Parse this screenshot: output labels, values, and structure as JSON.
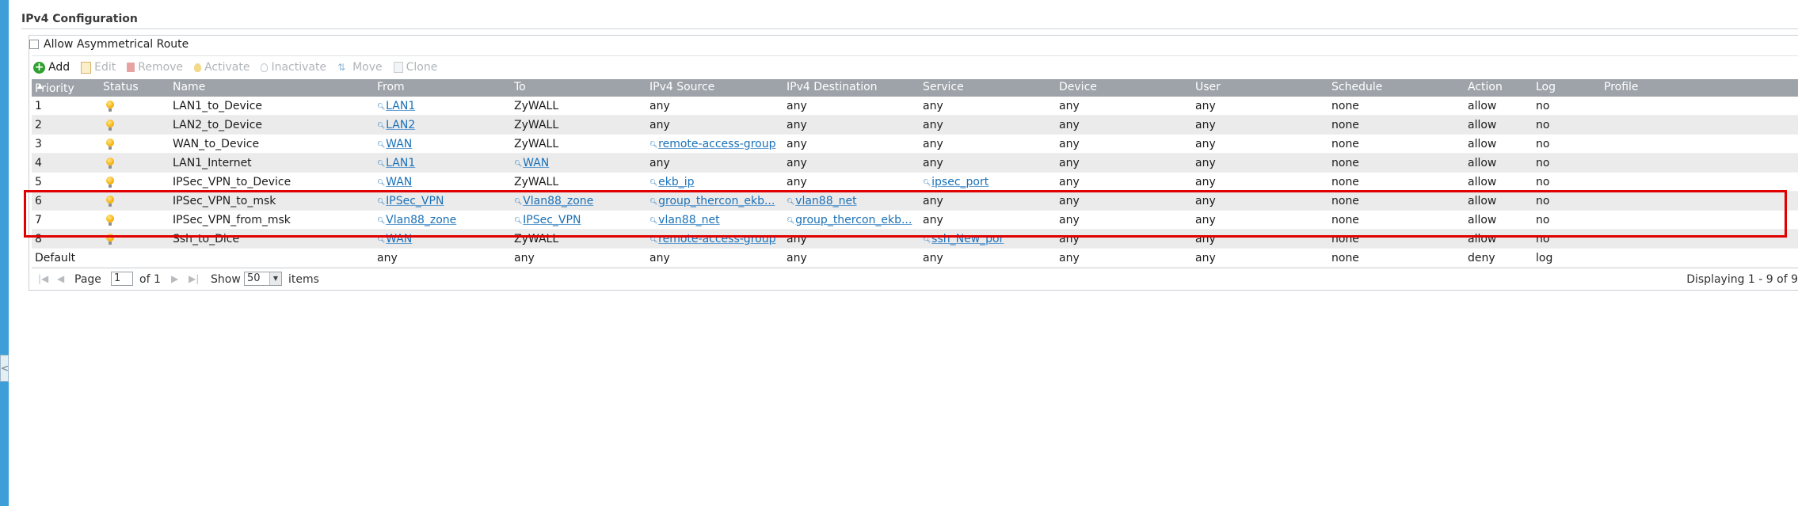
{
  "section_title": "IPv4 Configuration",
  "asymmetrical_route": {
    "label": "Allow Asymmetrical Route",
    "checked": false
  },
  "toolbar": {
    "add": "Add",
    "edit": "Edit",
    "remove": "Remove",
    "activate": "Activate",
    "inactivate": "Inactivate",
    "move": "Move",
    "clone": "Clone"
  },
  "columns": {
    "priority": "Priority",
    "status": "Status",
    "name": "Name",
    "from": "From",
    "to": "To",
    "ipv4_source": "IPv4 Source",
    "ipv4_destination": "IPv4 Destination",
    "service": "Service",
    "device": "Device",
    "user": "User",
    "schedule": "Schedule",
    "action": "Action",
    "log": "Log",
    "profile": "Profile"
  },
  "rows": [
    {
      "priority": "1",
      "name": "LAN1_to_Device",
      "from": "LAN1",
      "to": "ZyWALL",
      "source": "any",
      "destination": "any",
      "service": "any",
      "device": "any",
      "user": "any",
      "schedule": "none",
      "action": "allow",
      "log": "no"
    },
    {
      "priority": "2",
      "name": "LAN2_to_Device",
      "from": "LAN2",
      "to": "ZyWALL",
      "source": "any",
      "destination": "any",
      "service": "any",
      "device": "any",
      "user": "any",
      "schedule": "none",
      "action": "allow",
      "log": "no"
    },
    {
      "priority": "3",
      "name": "WAN_to_Device",
      "from": "WAN",
      "to": "ZyWALL",
      "source": "remote-access-group",
      "destination": "any",
      "service": "any",
      "device": "any",
      "user": "any",
      "schedule": "none",
      "action": "allow",
      "log": "no"
    },
    {
      "priority": "4",
      "name": "LAN1_Internet",
      "from": "LAN1",
      "to": "WAN",
      "source": "any",
      "destination": "any",
      "service": "any",
      "device": "any",
      "user": "any",
      "schedule": "none",
      "action": "allow",
      "log": "no"
    },
    {
      "priority": "5",
      "name": "IPSec_VPN_to_Device",
      "from": "WAN",
      "to": "ZyWALL",
      "source": "ekb_ip",
      "destination": "any",
      "service": "ipsec_port",
      "device": "any",
      "user": "any",
      "schedule": "none",
      "action": "allow",
      "log": "no"
    },
    {
      "priority": "6",
      "name": "IPSec_VPN_to_msk",
      "from": "IPSec_VPN",
      "to": "Vlan88_zone",
      "source": "group_thercon_ekb...",
      "destination": "vlan88_net",
      "service": "any",
      "device": "any",
      "user": "any",
      "schedule": "none",
      "action": "allow",
      "log": "no"
    },
    {
      "priority": "7",
      "name": "IPSec_VPN_from_msk",
      "from": "Vlan88_zone",
      "to": "IPSec_VPN",
      "source": "vlan88_net",
      "destination": "group_thercon_ekb...",
      "service": "any",
      "device": "any",
      "user": "any",
      "schedule": "none",
      "action": "allow",
      "log": "no"
    },
    {
      "priority": "8",
      "name": "Ssh_to_Dice",
      "from": "WAN",
      "to": "ZyWALL",
      "source": "remote-access-group",
      "destination": "any",
      "service": "ssh_New_por",
      "device": "any",
      "user": "any",
      "schedule": "none",
      "action": "allow",
      "log": "no"
    },
    {
      "priority": "Default",
      "name": "",
      "from": "any",
      "to": "any",
      "source": "any",
      "destination": "any",
      "service": "any",
      "device": "any",
      "user": "any",
      "schedule": "none",
      "action": "deny",
      "log": "log"
    }
  ],
  "pager": {
    "page_label": "Page",
    "page_value": "1",
    "of_label": "of 1",
    "show_label": "Show",
    "show_value": "50",
    "items_label": "items",
    "displaying": "Displaying 1 - 9 of 9"
  }
}
